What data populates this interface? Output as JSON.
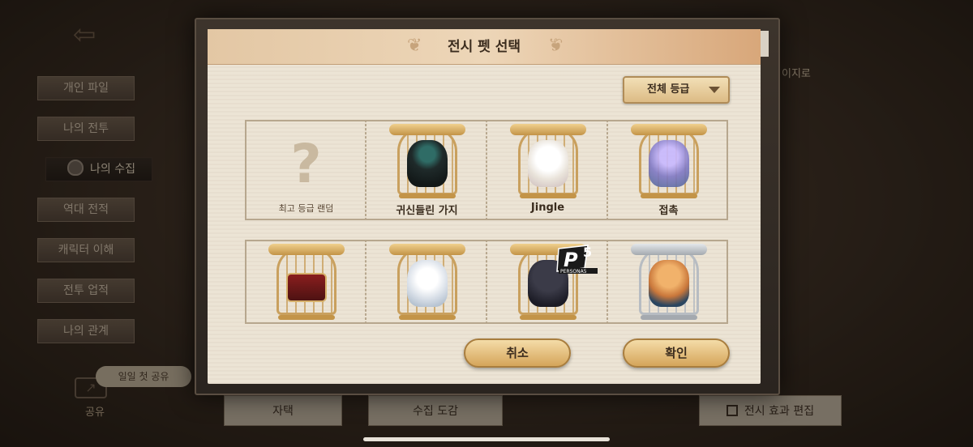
{
  "background": {
    "side_menu": [
      "개인 파일",
      "나의 전투",
      "나의 수집",
      "역대 전적",
      "캐릭터 이해",
      "전투 업적",
      "나의 관계"
    ],
    "active_index": 2,
    "share_pill": "일일 첫 공유",
    "share_label": "공유",
    "right_text": "이지로",
    "bottom_tabs": [
      "자택",
      "수집 도감",
      "전시 효과 편집"
    ]
  },
  "modal": {
    "title": "전시 펫 선택",
    "filter": "전체 등급",
    "cells": [
      {
        "label": "최고 등급 랜덤",
        "pet": "random-question-mark"
      },
      {
        "label": "귀신들린 가지",
        "pet": "haunted-branch-pet"
      },
      {
        "label": "Jingle",
        "pet": "white-dog-pet"
      },
      {
        "label": "접촉",
        "pet": "jellyfish-pet"
      },
      {
        "label": "",
        "pet": "red-chest-pet"
      },
      {
        "label": "",
        "pet": "white-wolf-pet"
      },
      {
        "label": "",
        "pet": "black-cat-pet"
      },
      {
        "label": "",
        "pet": "shiba-pet"
      }
    ],
    "p5_logo_text": "P5",
    "p5_logo_sub": "PERSONA5",
    "cancel": "취소",
    "confirm": "확인"
  }
}
